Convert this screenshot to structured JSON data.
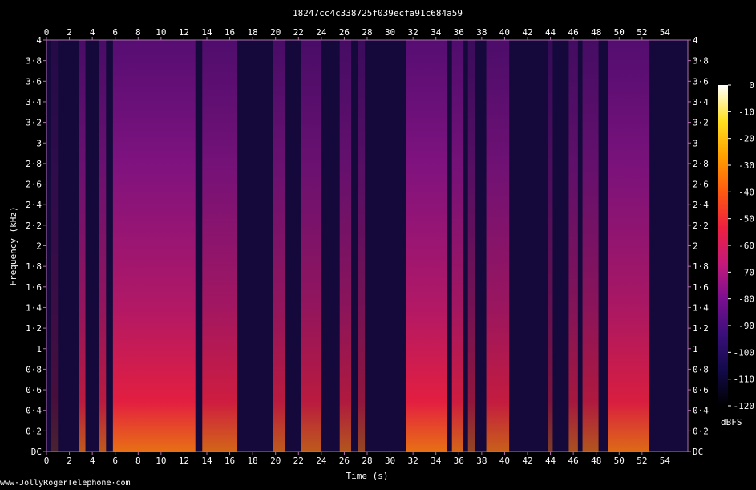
{
  "chart_data": {
    "type": "heatmap",
    "title": "18247cc4c338725f039ecfa91c684a59",
    "xlabel": "Time (s)",
    "ylabel": "Frequency (kHz)",
    "xlim": [
      0,
      56
    ],
    "ylim": [
      0,
      4
    ],
    "x_ticks": [
      "0",
      "2",
      "4",
      "6",
      "8",
      "10",
      "12",
      "14",
      "16",
      "18",
      "20",
      "22",
      "24",
      "26",
      "28",
      "30",
      "32",
      "34",
      "36",
      "38",
      "40",
      "42",
      "44",
      "46",
      "48",
      "50",
      "52",
      "54"
    ],
    "y_ticks": [
      "DC",
      "0·2",
      "0·4",
      "0·6",
      "0·8",
      "1",
      "1·2",
      "1·4",
      "1·6",
      "1·8",
      "2",
      "2·2",
      "2·4",
      "2·6",
      "2·8",
      "3",
      "3·2",
      "3·4",
      "3·6",
      "3·8",
      "4"
    ],
    "colorbar": {
      "label": "dBFS",
      "ticks": [
        "0",
        "-10",
        "-20",
        "-30",
        "-40",
        "-50",
        "-60",
        "-70",
        "-80",
        "-90",
        "-100",
        "-110",
        "-120"
      ],
      "range": [
        -120,
        0
      ],
      "stops": [
        "#000000",
        "#120a4a",
        "#3a0f7a",
        "#7a0f90",
        "#c41a7a",
        "#ee2040",
        "#ff5a10",
        "#ffa000",
        "#ffe020",
        "#ffffff"
      ]
    },
    "active_segments_s": [
      [
        0.4,
        1.0,
        0.25
      ],
      [
        2.8,
        3.4,
        0.8
      ],
      [
        4.6,
        5.2,
        0.8
      ],
      [
        5.8,
        13.0,
        1.0
      ],
      [
        13.6,
        16.6,
        0.9
      ],
      [
        19.8,
        20.8,
        0.8
      ],
      [
        22.2,
        24.0,
        0.8
      ],
      [
        25.6,
        26.6,
        0.75
      ],
      [
        27.2,
        27.8,
        0.6
      ],
      [
        31.4,
        35.0,
        1.0
      ],
      [
        35.4,
        36.4,
        0.9
      ],
      [
        36.8,
        37.4,
        0.6
      ],
      [
        38.4,
        40.4,
        0.85
      ],
      [
        43.8,
        44.2,
        0.5
      ],
      [
        45.6,
        46.4,
        0.7
      ],
      [
        46.8,
        48.2,
        0.75
      ],
      [
        49.0,
        52.6,
        0.95
      ]
    ]
  },
  "watermark": "www·JollyRogerTelephone·com"
}
